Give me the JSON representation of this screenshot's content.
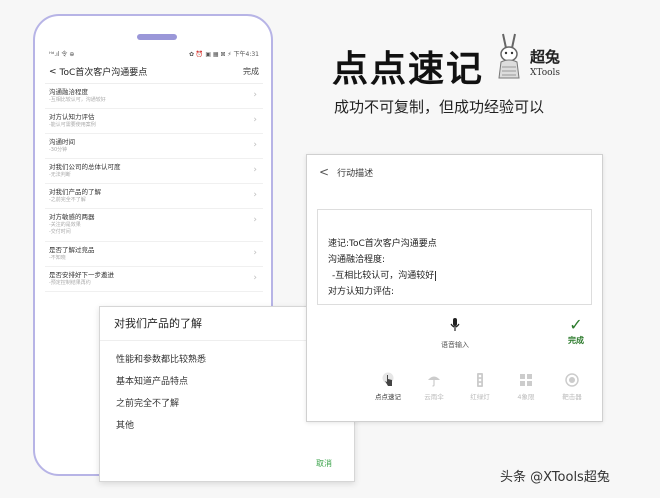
{
  "hero": {
    "title": "点点速记",
    "subtitle": "成功不可复制，但成功经验可以",
    "brand_cn": "超兔",
    "brand_en": "XTools"
  },
  "phone": {
    "status_left": "ᴴᵈ.ıl 令 ⊕",
    "status_right": "✿ ⏰ ▣ ▦ ⊠ ⚡ 下午4:31",
    "nav_back": "<",
    "nav_title": "ToC首次客户沟通要点",
    "nav_done": "完成",
    "rows": [
      {
        "title": "沟通融洽程度",
        "sub": "-互相比较认可，沟通较好"
      },
      {
        "title": "对方认知力评估",
        "sub": "-能认可需要使用案例"
      },
      {
        "title": "沟通时间",
        "sub": "-30分钟"
      },
      {
        "title": "对我们公司的总体认可度",
        "sub": "-无法判断"
      },
      {
        "title": "对我们产品的了解",
        "sub": "-之前完全不了解"
      },
      {
        "title": "对方敏感的两器",
        "sub": "-关注的是效果",
        "sub2": "-交付时间"
      },
      {
        "title": "是否了解过竞品",
        "sub": "-不知晓"
      },
      {
        "title": "是否安排好下一步邀进",
        "sub": "-预定控制结果再约"
      }
    ]
  },
  "dialog": {
    "title": "对我们产品的了解",
    "options": [
      "性能和参数都比较熟悉",
      "基本知道产品特点",
      "之前完全不了解",
      "其他"
    ],
    "selected_index": 2,
    "cancel": "取消"
  },
  "editor_card": {
    "back": "<",
    "title": "行动描述",
    "lines": [
      "速记:ToC首次客户沟通要点",
      "沟通融洽程度:",
      "-互相比较认可，沟通较好",
      "对方认知力评估:"
    ],
    "voice_label": "语音输入",
    "done_label": "完成",
    "tools": [
      {
        "label": "点点速记",
        "icon": "hand-tap-icon",
        "active": true
      },
      {
        "label": "云雨伞",
        "icon": "umbrella-icon",
        "active": false
      },
      {
        "label": "红绿灯",
        "icon": "traffic-light-icon",
        "active": false
      },
      {
        "label": "4象限",
        "icon": "quadrant-icon",
        "active": false
      },
      {
        "label": "靶击器",
        "icon": "target-icon",
        "active": false
      }
    ]
  },
  "watermark": "头条 @XTools超兔",
  "colors": {
    "phone_frame": "#b7b4e6",
    "accent_green": "#2b7a2b",
    "cancel_green": "#3aa34a"
  }
}
